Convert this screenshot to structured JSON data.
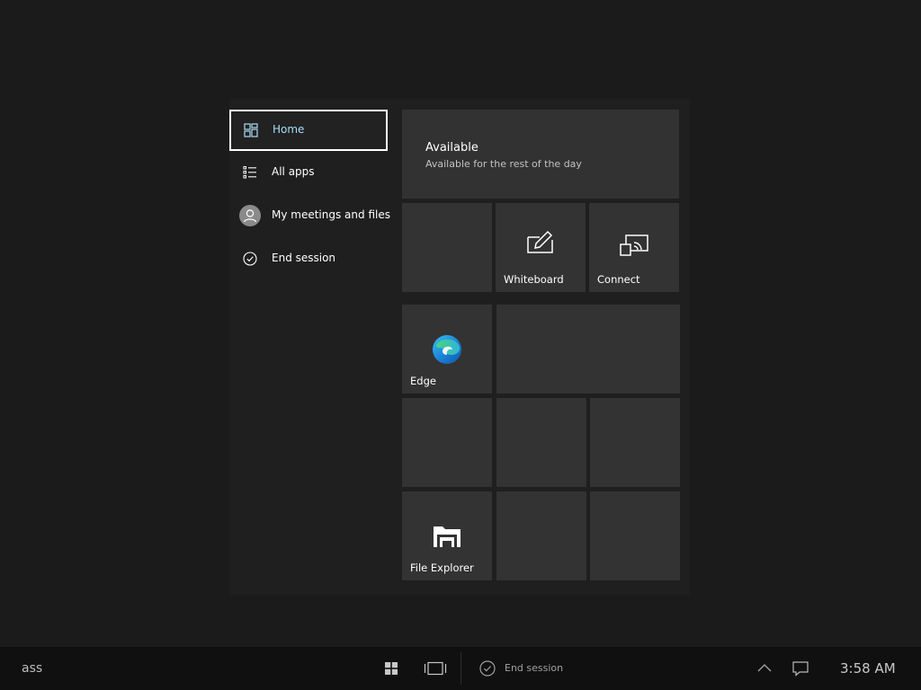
{
  "nav": {
    "items": [
      {
        "label": "Home",
        "icon": "home-icon",
        "selected": true
      },
      {
        "label": "All apps",
        "icon": "list-icon",
        "selected": false
      },
      {
        "label": "My meetings and files",
        "icon": "person-avatar-icon",
        "selected": false
      },
      {
        "label": "End session",
        "icon": "checkmark-circle-icon",
        "selected": false
      }
    ]
  },
  "status": {
    "title": "Available",
    "subtitle": "Available for the rest of the day"
  },
  "tiles": {
    "whiteboard": "Whiteboard",
    "connect": "Connect",
    "edge": "Edge",
    "file_explorer": "File Explorer"
  },
  "taskbar": {
    "left_text": "ass",
    "end_session": "End session",
    "time": "3:58 AM",
    "icons": [
      "windows-start-icon",
      "task-view-icon",
      "checkmark-circle-icon",
      "chevron-up-icon",
      "notification-icon"
    ]
  },
  "colors": {
    "background": "#1b1b1b",
    "tile": "#333333",
    "selected_text": "#a7dcf5",
    "taskbar": "#101010"
  }
}
